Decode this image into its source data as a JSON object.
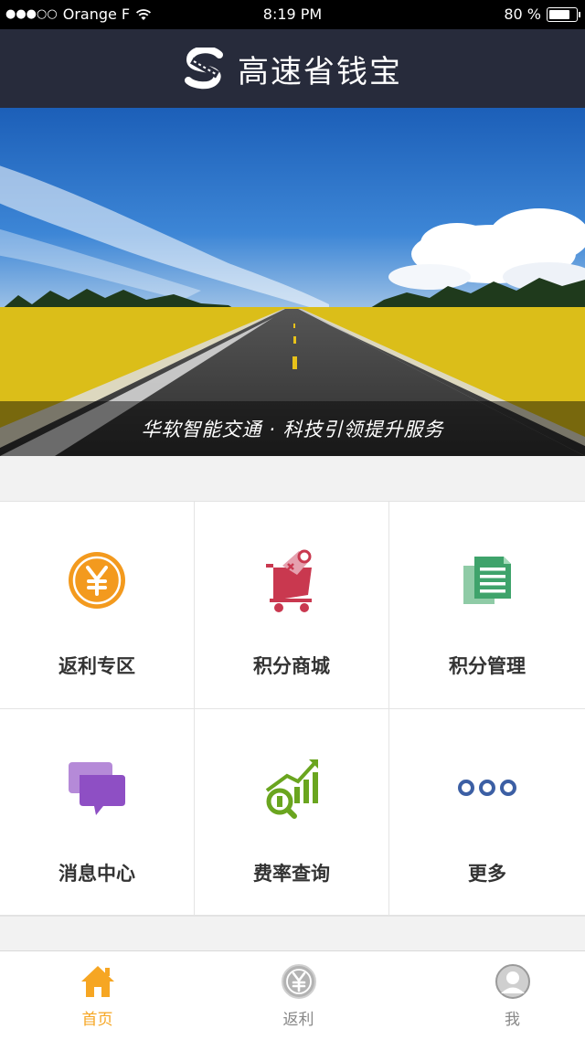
{
  "status_bar": {
    "signal_dots": "●●●○○",
    "carrier": "Orange F",
    "time": "8:19 PM",
    "battery_percent": "80 %",
    "battery_level": 0.8
  },
  "header": {
    "title": "高速省钱宝",
    "logo_icon": "s-road-logo-icon"
  },
  "banner": {
    "caption": "华软智能交通 · 科技引领提升服务"
  },
  "grid": {
    "items": [
      {
        "label": "返利专区",
        "icon": "yuan-coin-icon",
        "color": "#f39a1e"
      },
      {
        "label": "积分商城",
        "icon": "shopping-cart-icon",
        "color": "#c9384f"
      },
      {
        "label": "积分管理",
        "icon": "documents-icon",
        "color": "#3fa36b"
      },
      {
        "label": "消息中心",
        "icon": "chat-bubbles-icon",
        "color": "#8e4fc4"
      },
      {
        "label": "费率查询",
        "icon": "chart-search-icon",
        "color": "#6aa51f"
      },
      {
        "label": "更多",
        "icon": "more-dots-icon",
        "color": "#3c5fa4"
      }
    ]
  },
  "tabbar": {
    "items": [
      {
        "label": "首页",
        "icon": "home-icon",
        "active": true
      },
      {
        "label": "返利",
        "icon": "yuan-coin-icon",
        "active": false
      },
      {
        "label": "我",
        "icon": "user-icon",
        "active": false
      }
    ],
    "active_color": "#f6a623"
  }
}
